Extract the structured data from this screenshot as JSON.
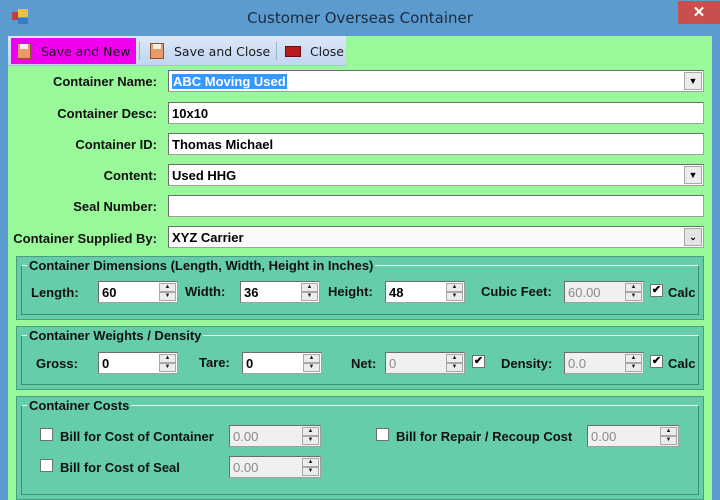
{
  "window": {
    "title": "Customer Overseas Container",
    "close_glyph": "✕"
  },
  "toolbar": {
    "save_new": "Save and New",
    "save_close": "Save and Close",
    "close": "Close"
  },
  "form": {
    "container_name": {
      "label": "Container Name:",
      "value": "ABC Moving Used"
    },
    "container_desc": {
      "label": "Container Desc:",
      "value": "10x10"
    },
    "container_id": {
      "label": "Container ID:",
      "value": "Thomas Michael"
    },
    "content": {
      "label": "Content:",
      "value": "Used HHG"
    },
    "seal_number": {
      "label": "Seal Number:",
      "value": ""
    },
    "supplied_by": {
      "label": "Container Supplied By:",
      "value": "XYZ Carrier"
    }
  },
  "dimensions": {
    "title": "Container Dimensions (Length, Width, Height in Inches)",
    "length": {
      "label": "Length:",
      "value": "60"
    },
    "width": {
      "label": "Width:",
      "value": "36"
    },
    "height": {
      "label": "Height:",
      "value": "48"
    },
    "cubic_feet": {
      "label": "Cubic Feet:",
      "value": "60.00"
    },
    "calc": {
      "label": "Calc",
      "checked": true
    }
  },
  "weights": {
    "title": "Container Weights / Density",
    "gross": {
      "label": "Gross:",
      "value": "0"
    },
    "tare": {
      "label": "Tare:",
      "value": "0"
    },
    "net": {
      "label": "Net:",
      "value": "0",
      "checked": true
    },
    "density": {
      "label": "Density:",
      "value": "0.0"
    },
    "calc": {
      "label": "Calc",
      "checked": true
    }
  },
  "costs": {
    "title": "Container Costs",
    "container_cost": {
      "label": "Bill for Cost of Container",
      "value": "0.00",
      "checked": false
    },
    "seal_cost": {
      "label": "Bill for Cost of Seal",
      "value": "0.00",
      "checked": false
    },
    "repair_cost": {
      "label": "Bill for Repair / Recoup Cost",
      "value": "0.00",
      "checked": false
    }
  },
  "glyphs": {
    "check": "✔",
    "dropdown": "▼",
    "chevron": "⌄",
    "up": "▲",
    "down": "▼"
  }
}
